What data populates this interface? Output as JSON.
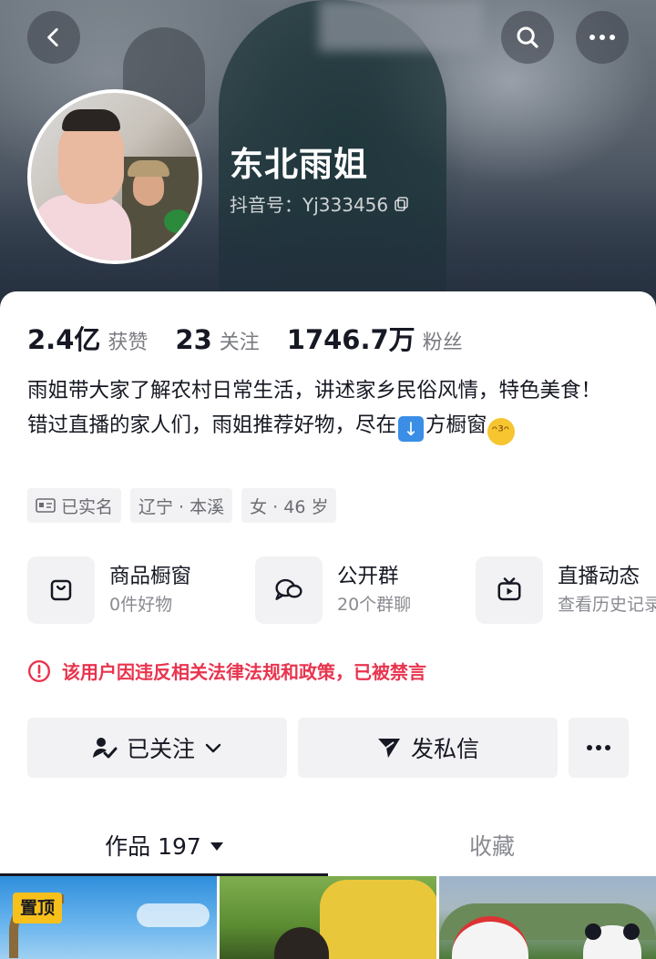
{
  "header": {
    "nickname": "东北雨姐",
    "douyin_id": "抖音号：Yj333456"
  },
  "stats": [
    {
      "value": "2.4亿",
      "label": "获赞"
    },
    {
      "value": "23",
      "label": "关注"
    },
    {
      "value": "1746.7万",
      "label": "粉丝"
    }
  ],
  "bio": {
    "line1": "雨姐带大家了解农村日常生活，讲述家乡民俗风情，特色美食！",
    "line2_before": "错过直播的家人们，雨姐推荐好物，尽在",
    "line2_emoji": "⬇️",
    "line2_after": "方橱窗",
    "line2_end_emoji": "😘"
  },
  "tags": [
    {
      "label": "已实名",
      "icon": "id-card-icon"
    },
    {
      "label": "辽宁 · 本溪"
    },
    {
      "label": "女 · 46 岁"
    }
  ],
  "shortcuts": [
    {
      "title": "商品橱窗",
      "subtitle": "0件好物",
      "icon": "shopping-bag-icon"
    },
    {
      "title": "公开群",
      "subtitle": "20个群聊",
      "icon": "chat-bubbles-icon"
    },
    {
      "title": "直播动态",
      "subtitle": "查看历史记录",
      "icon": "tv-icon"
    }
  ],
  "warning": "该用户因违反相关法律法规和政策，已被禁言",
  "actions": {
    "follow": "已关注",
    "message": "发私信",
    "more": "···"
  },
  "tabs": {
    "works": "作品 197",
    "favorites": "收藏"
  },
  "grid": {
    "pin_badge": "置顶"
  },
  "colors": {
    "warning_red": "#e8344e",
    "text_primary": "#161823",
    "text_secondary": "#8a8b91",
    "chip_bg": "#f2f2f4",
    "pin_yellow": "#f8c01a"
  }
}
